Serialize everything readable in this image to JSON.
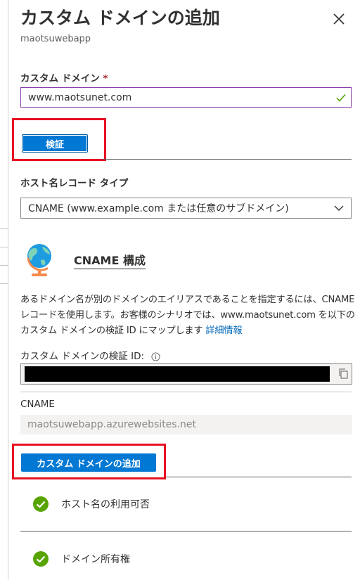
{
  "header": {
    "title": "カスタム ドメインの追加",
    "subtitle": "maotsuwebapp"
  },
  "custom_domain": {
    "label": "カスタム ドメイン",
    "required_marker": "*",
    "value": "www.maotsunet.com"
  },
  "verify_button_label": "検証",
  "hostname_record": {
    "label": "ホスト名レコード タイプ",
    "selected": "CNAME (www.example.com または任意のサブドメイン)"
  },
  "cname_section": {
    "heading": "CNAME 構成",
    "description": "あるドメイン名が別のドメインのエイリアスであることを指定するには、CNAME レコードを使用します。お客様のシナリオでは、www.maotsunet.com を以下のカスタム ドメインの検証 ID にマップします",
    "more_info_link": "詳細情報",
    "verification_id_label": "カスタム ドメインの検証 ID:",
    "cname_label": "CNAME",
    "cname_value": "maotsuwebapp.azurewebsites.net"
  },
  "add_button_label": "カスタム ドメインの追加",
  "status_items": [
    {
      "label": "ホスト名の利用可否",
      "state": "success"
    },
    {
      "label": "ドメイン所有権",
      "state": "success"
    }
  ],
  "colors": {
    "primary": "#0078d4",
    "success": "#57a300",
    "highlight_box": "#e81123"
  },
  "icons": [
    "close-icon",
    "checkmark-icon",
    "chevron-down-icon",
    "globe-icon",
    "info-icon",
    "copy-icon",
    "success-check-icon"
  ]
}
